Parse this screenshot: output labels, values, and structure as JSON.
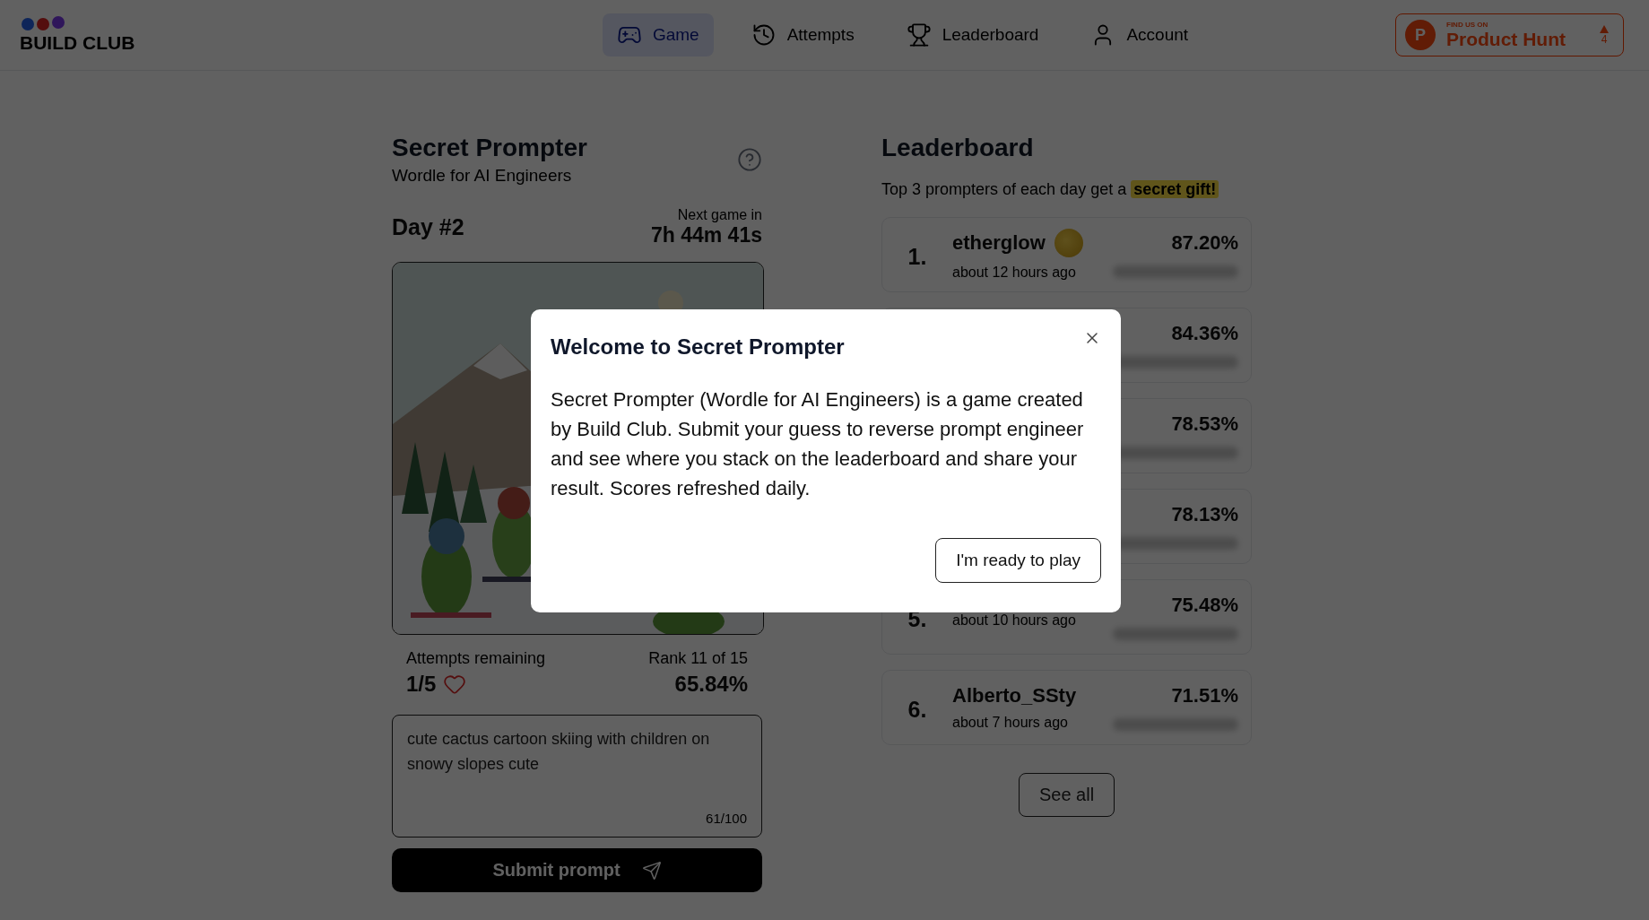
{
  "header": {
    "logo": "BUILD CLUB",
    "nav": [
      {
        "label": "Game",
        "kind": "game",
        "selected": true
      },
      {
        "label": "Attempts",
        "kind": "history",
        "selected": false
      },
      {
        "label": "Leaderboard",
        "kind": "trophy",
        "selected": false
      },
      {
        "label": "Account",
        "kind": "user",
        "selected": false
      }
    ],
    "product_hunt": {
      "logo": "P",
      "caption": "FIND US ON",
      "name": "Product Hunt",
      "votes": "4"
    }
  },
  "game": {
    "title": "Secret Prompter",
    "subtitle": "Wordle for AI Engineers",
    "day": "Day #2",
    "next_label": "Next game in",
    "countdown": "7h 44m 41s",
    "attempts_label": "Attempts remaining",
    "attempts": "1/5",
    "rank": "Rank 11 of 15",
    "score": "65.84%",
    "prompt": {
      "value": "cute cactus cartoon skiing with children on snowy slopes cute",
      "counter": "61/100"
    },
    "submit": "Submit prompt"
  },
  "leaderboard": {
    "title": "Leaderboard",
    "subtitle": "Top 3 prompters of each day get a",
    "highlight": "secret gift!",
    "entries": [
      {
        "rank": "1.",
        "name": "etherglow",
        "time": "about 12 hours ago",
        "score": "87.20%",
        "medal": true
      },
      {
        "score": "84.36%"
      },
      {
        "score": "78.53%"
      },
      {
        "score": "78.13%"
      },
      {
        "rank": "5.",
        "time": "about 10 hours ago",
        "score": "75.48%"
      },
      {
        "rank": "6.",
        "name": "Alberto_SSty",
        "time": "about 7 hours ago",
        "score": "71.51%",
        "medal": false
      }
    ],
    "see_all": "See all"
  },
  "modal": {
    "title": "Welcome to Secret Prompter",
    "body": "Secret Prompter (Wordle for AI Engineers) is a game created by Build Club. Submit your guess to reverse prompt engineer and see where you stack on the leaderboard and share your result. Scores refreshed daily.",
    "button": "I'm ready to play"
  }
}
